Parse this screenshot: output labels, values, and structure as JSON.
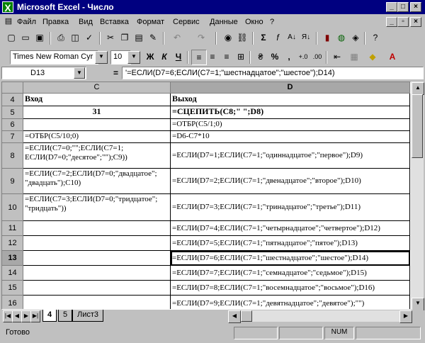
{
  "window": {
    "title": "Microsoft Excel - Число",
    "app_icon": "excel-x-icon"
  },
  "menu": [
    "Файл",
    "Правка",
    "Вид",
    "Вставка",
    "Формат",
    "Сервис",
    "Данные",
    "Окно",
    "?"
  ],
  "format": {
    "font": "Times New Roman Cyr",
    "size": "10",
    "bold": "Ж",
    "italic": "К",
    "underline": "Ч",
    "currency": "%",
    "comma": ","
  },
  "formula_bar": {
    "name_box": "D13",
    "equals": "=",
    "content": "'=ЕСЛИ(D7=6;ЕСЛИ(C7=1;\"шестнадцатое\";\"шестое\");D14)"
  },
  "columns": [
    "C",
    "D"
  ],
  "rows": [
    {
      "n": "4",
      "c": "Вход",
      "d": "Выход"
    },
    {
      "n": "5",
      "c": "31",
      "d": "=СЦЕПИТЬ(C8;\" \";D8)"
    },
    {
      "n": "6",
      "c": "",
      "d": "=ОТБР(C5/1;0)"
    },
    {
      "n": "7",
      "c": "=ОТБР(C5/10;0)",
      "d": "=D6-C7*10"
    },
    {
      "n": "8",
      "c": "=ЕСЛИ(C7=0;\"\";ЕСЛИ(C7=1; ЕСЛИ(D7=0;\"десятое\";\"\");C9))",
      "d": "=ЕСЛИ(D7=1;ЕСЛИ(C7=1;\"одиннадцатое\";\"первое\");D9)"
    },
    {
      "n": "9",
      "c": "=ЕСЛИ(C7=2;ЕСЛИ(D7=0;\"двадцатое\"; \"двадцать\");C10)",
      "d": "=ЕСЛИ(D7=2;ЕСЛИ(C7=1;\"двенадцатое\";\"второе\");D10)"
    },
    {
      "n": "10",
      "c": "=ЕСЛИ(C7=3;ЕСЛИ(D7=0;\"тридцатое\"; \"тридцать\"))",
      "d": "=ЕСЛИ(D7=3;ЕСЛИ(C7=1;\"тринадцатое\";\"третье\");D11)"
    },
    {
      "n": "11",
      "c": "",
      "d": "=ЕСЛИ(D7=4;ЕСЛИ(C7=1;\"четырнадцатое\";\"четвертое\");D12)"
    },
    {
      "n": "12",
      "c": "",
      "d": "=ЕСЛИ(D7=5;ЕСЛИ(C7=1;\"пятнадцатое\";\"пятое\");D13)"
    },
    {
      "n": "13",
      "c": "",
      "d": "=ЕСЛИ(D7=6;ЕСЛИ(C7=1;\"шестнадцатое\";\"шестое\");D14)"
    },
    {
      "n": "14",
      "c": "",
      "d": "=ЕСЛИ(D7=7;ЕСЛИ(C7=1;\"семнадцатое\";\"седьмое\");D15)"
    },
    {
      "n": "15",
      "c": "",
      "d": "=ЕСЛИ(D7=8;ЕСЛИ(C7=1;\"восемнадцатое\";\"восьмое\");D16)"
    },
    {
      "n": "16",
      "c": "",
      "d": "=ЕСЛИ(D7=9;ЕСЛИ(C7=1;\"девятнадцатое\";\"девятое\");\"\")"
    }
  ],
  "sheets": [
    "4",
    "5",
    "Лист3"
  ],
  "status": {
    "text": "Готово",
    "num": "NUM"
  }
}
